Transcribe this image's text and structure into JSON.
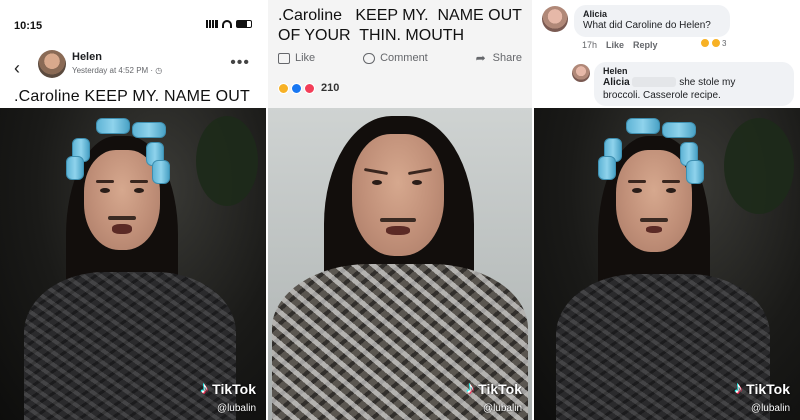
{
  "panel1": {
    "status_time": "10:15",
    "post": {
      "author": "Helen",
      "meta": "Yesterday at 4:52 PM · ◷",
      "text": ".Caroline   KEEP MY.  NAME  OUT"
    },
    "watermark": {
      "brand": "TikTok",
      "handle": "@lubalin"
    }
  },
  "panel2": {
    "text": ".Caroline   KEEP MY.  NAME OUT\nOF YOUR  THIN. MOUTH",
    "actions": {
      "like": "Like",
      "comment": "Comment",
      "share": "Share"
    },
    "reaction_count": "210",
    "watermark": {
      "brand": "TikTok",
      "handle": "@lubalin"
    }
  },
  "panel3": {
    "comment1": {
      "name": "Alicia",
      "text": "What did Caroline do Helen?",
      "time": "17h",
      "like": "Like",
      "reply": "Reply",
      "reaction_count": "3"
    },
    "comment2": {
      "name": "Helen",
      "mention": "Alicia",
      "text_after_mention": "she stole my",
      "text_line2": "broccoli. Casserole recipe."
    },
    "watermark": {
      "brand": "TikTok",
      "handle": "@lubalin"
    }
  },
  "icons": {
    "back": "chevron-left-icon",
    "more": "more-dots-icon",
    "like": "thumbs-up-icon",
    "comment": "comment-bubble-icon",
    "share": "share-arrow-icon",
    "tiktok": "tiktok-logo-icon"
  },
  "colors": {
    "facebook_blue": "#1877f2",
    "curler_blue": "#6cc3e2",
    "haha": "#f7b125",
    "love": "#f33e58"
  }
}
